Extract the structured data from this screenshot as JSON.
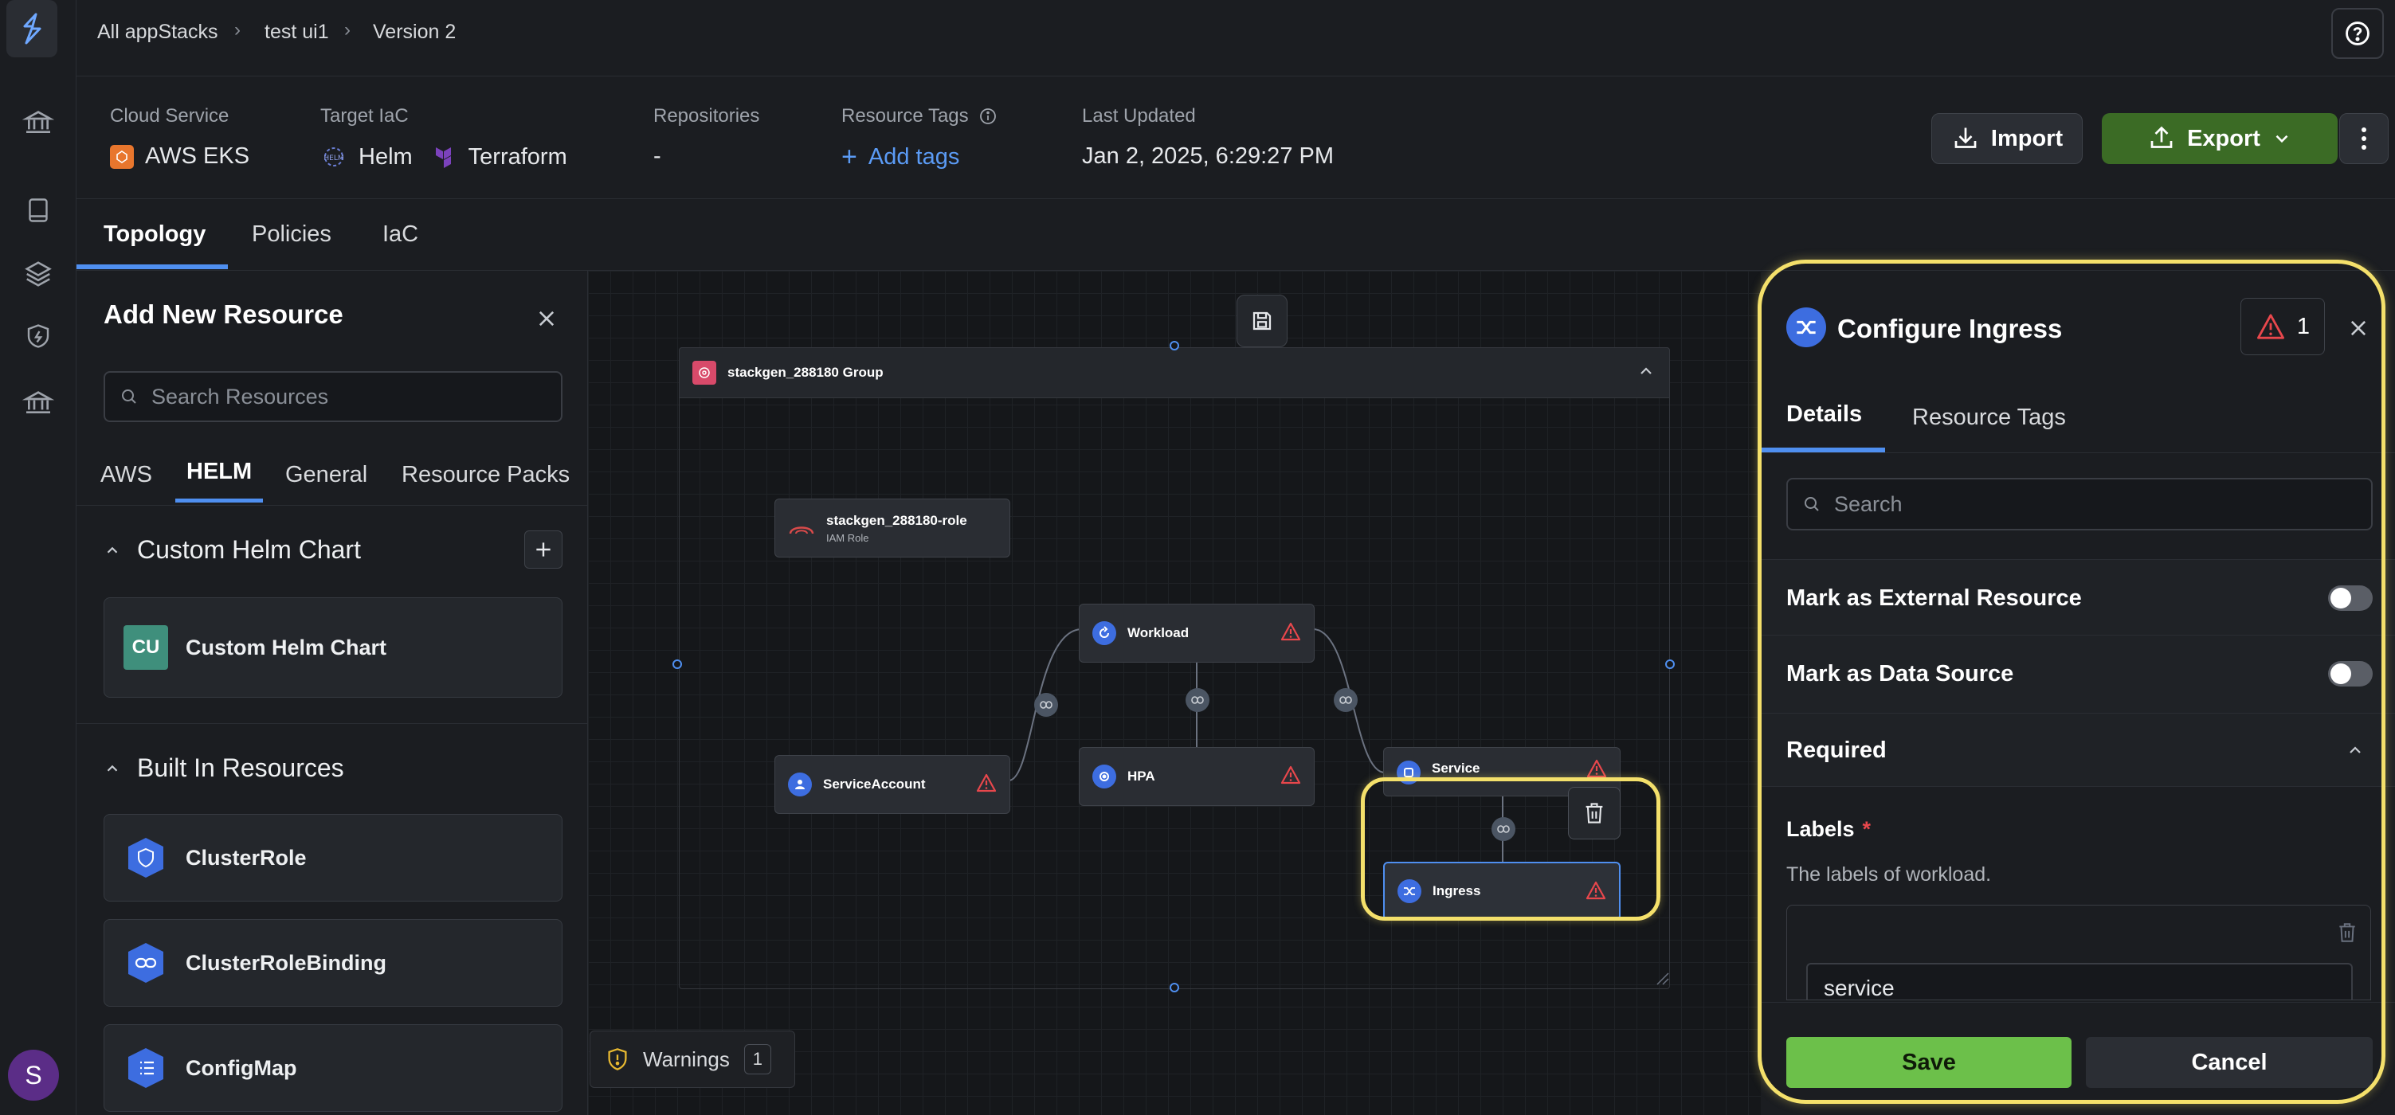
{
  "breadcrumb": {
    "items": [
      "All appStacks",
      "test ui1",
      "Version 2"
    ]
  },
  "info": {
    "cloud_service_label": "Cloud Service",
    "cloud_service_value": "AWS EKS",
    "target_iac_label": "Target IaC",
    "target_iac_values": [
      "Helm",
      "Terraform"
    ],
    "repositories_label": "Repositories",
    "repositories_value": "-",
    "resource_tags_label": "Resource Tags",
    "add_tags_label": "Add tags",
    "last_updated_label": "Last Updated",
    "last_updated_value": "Jan 2, 2025, 6:29:27 PM"
  },
  "actions": {
    "import_label": "Import",
    "export_label": "Export"
  },
  "main_tabs": [
    "Topology",
    "Policies",
    "IaC"
  ],
  "left_panel": {
    "title": "Add New Resource",
    "search_placeholder": "Search Resources",
    "tabs": [
      "AWS",
      "HELM",
      "General",
      "Resource Packs"
    ],
    "custom_section_title": "Custom Helm Chart",
    "custom_card_badge": "CU",
    "custom_card_label": "Custom Helm Chart",
    "builtin_section_title": "Built In Resources",
    "builtin_items": [
      "ClusterRole",
      "ClusterRoleBinding",
      "ConfigMap"
    ]
  },
  "canvas": {
    "group_title": "stackgen_288180 Group",
    "nodes": {
      "role_name": "stackgen_288180-role",
      "role_type": "IAM Role",
      "workload": "Workload",
      "service_account": "ServiceAccount",
      "hpa": "HPA",
      "service": "Service",
      "ingress": "Ingress"
    },
    "warnings_label": "Warnings",
    "warnings_count": "1"
  },
  "right_panel": {
    "title": "Configure Ingress",
    "warning_count": "1",
    "tabs": [
      "Details",
      "Resource Tags"
    ],
    "search_placeholder": "Search",
    "mark_external_label": "Mark as External Resource",
    "mark_datasource_label": "Mark as Data Source",
    "required_section": "Required",
    "labels_title": "Labels",
    "labels_required_mark": "*",
    "labels_description": "The labels of workload.",
    "label_value": "service",
    "save_label": "Save",
    "cancel_label": "Cancel"
  },
  "user": {
    "avatar_initial": "S"
  },
  "colors": {
    "accent_blue": "#4f8ff0",
    "export_green": "#3b6b25",
    "save_green": "#6cc04a",
    "warning_red": "#e8474c",
    "highlight_yellow": "#f4e06b"
  }
}
